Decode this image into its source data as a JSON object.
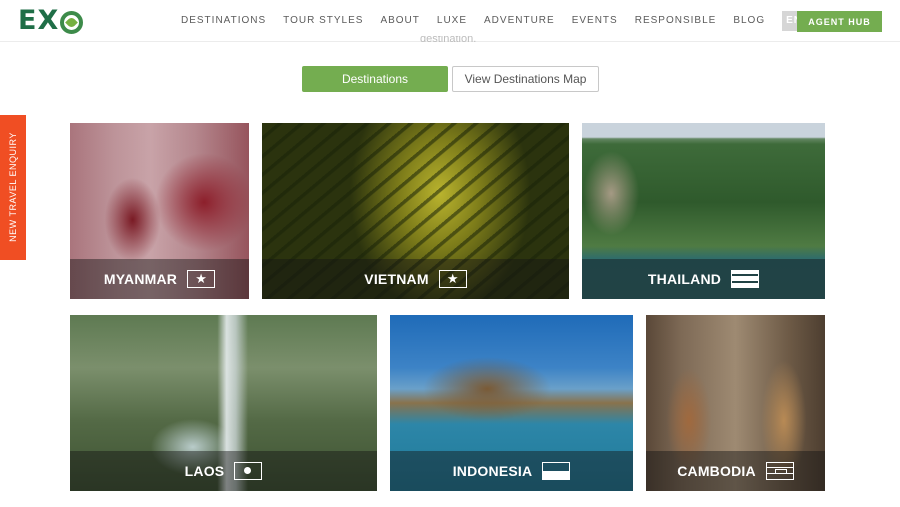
{
  "header": {
    "logo_text": "EX",
    "nav": [
      "DESTINATIONS",
      "TOUR STYLES",
      "ABOUT",
      "LUXE",
      "ADVENTURE",
      "EVENTS",
      "RESPONSIBLE",
      "BLOG"
    ],
    "enquire_label": "ENQUIRE",
    "agent_hub_label": "AGENT HUB",
    "brand_color": "#1f6e47",
    "accent_color": "#74ad50"
  },
  "partial_text": "destination.",
  "tabs": {
    "destinations_label": "Destinations",
    "map_label": "View Destinations Map"
  },
  "side_tab": {
    "label": "NEW TRAVEL ENQUIRY",
    "color": "#f04e23"
  },
  "destinations": [
    {
      "name": "MYANMAR",
      "flag_icon": "star-flag-icon"
    },
    {
      "name": "VIETNAM",
      "flag_icon": "star-flag-icon"
    },
    {
      "name": "THAILAND",
      "flag_icon": "striped-flag-icon"
    },
    {
      "name": "LAOS",
      "flag_icon": "dot-flag-icon"
    },
    {
      "name": "INDONESIA",
      "flag_icon": "bicolor-flag-icon"
    },
    {
      "name": "CAMBODIA",
      "flag_icon": "temple-flag-icon"
    }
  ]
}
